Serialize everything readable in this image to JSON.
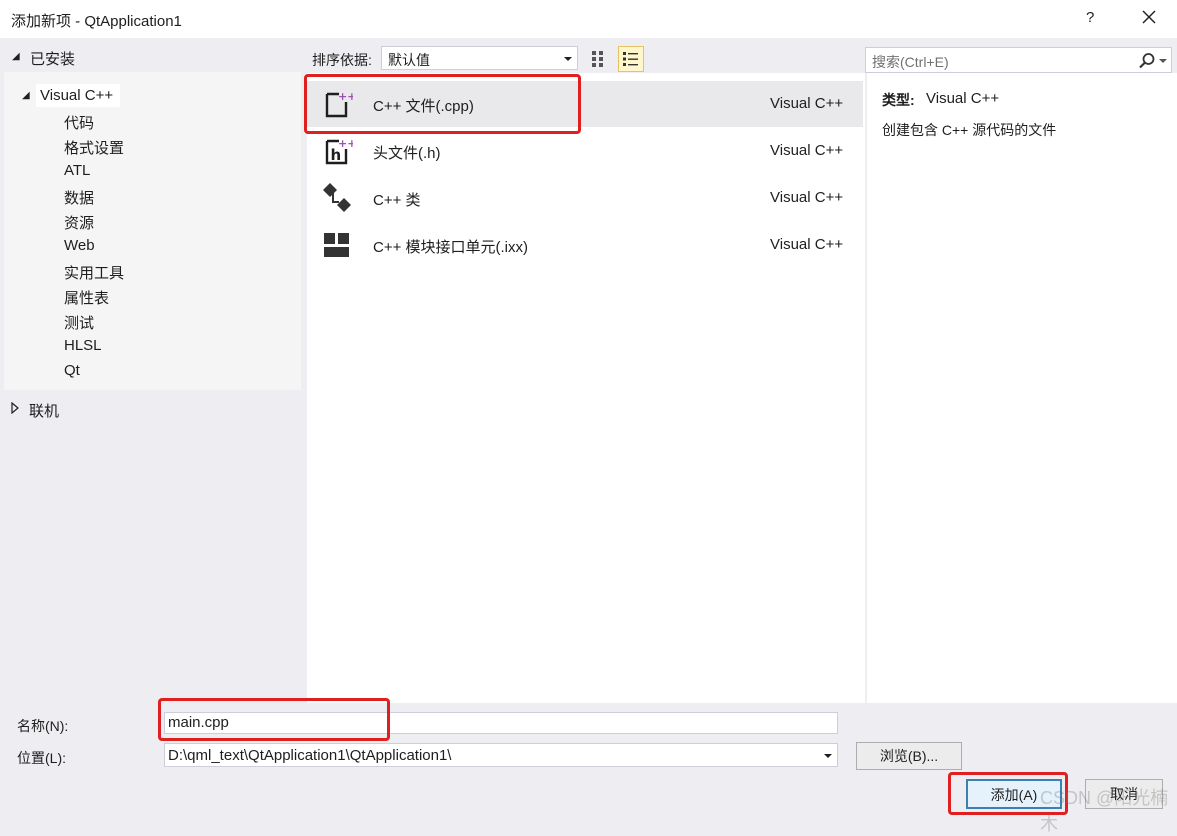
{
  "window": {
    "title": "添加新项 - QtApplication1",
    "help": "?",
    "close_icon": "close-icon"
  },
  "tree": {
    "installed": "已安装",
    "root": "Visual C++",
    "children": [
      "代码",
      "格式设置",
      "ATL",
      "数据",
      "资源",
      "Web",
      "实用工具",
      "属性表",
      "测试",
      "HLSL",
      "Qt"
    ],
    "online": "联机"
  },
  "toolbar": {
    "sort_label": "排序依据:",
    "sort_value": "默认值"
  },
  "search": {
    "placeholder": "搜索(Ctrl+E)"
  },
  "items": [
    {
      "name": "C++ 文件(.cpp)",
      "lang": "Visual C++",
      "icon": "cpp-file-icon",
      "selected": true
    },
    {
      "name": "头文件(.h)",
      "lang": "Visual C++",
      "icon": "header-file-icon",
      "selected": false
    },
    {
      "name": "C++ 类",
      "lang": "Visual C++",
      "icon": "cpp-class-icon",
      "selected": false
    },
    {
      "name": "C++ 模块接口单元(.ixx)",
      "lang": "Visual C++",
      "icon": "module-icon",
      "selected": false
    }
  ],
  "description": {
    "type_key": "类型:",
    "type_value": "Visual C++",
    "text": "创建包含 C++ 源代码的文件"
  },
  "form": {
    "name_label": "名称(N):",
    "name_value": "main.cpp",
    "location_label": "位置(L):",
    "location_value": "D:\\qml_text\\QtApplication1\\QtApplication1\\",
    "browse": "浏览(B)...",
    "add": "添加(A)",
    "cancel": "取消"
  },
  "watermark": "CSDN @阳光楠木",
  "colors": {
    "highlight": "#e02020",
    "selected_row": "#e9e9ec",
    "accent": "#3c7fb1"
  }
}
